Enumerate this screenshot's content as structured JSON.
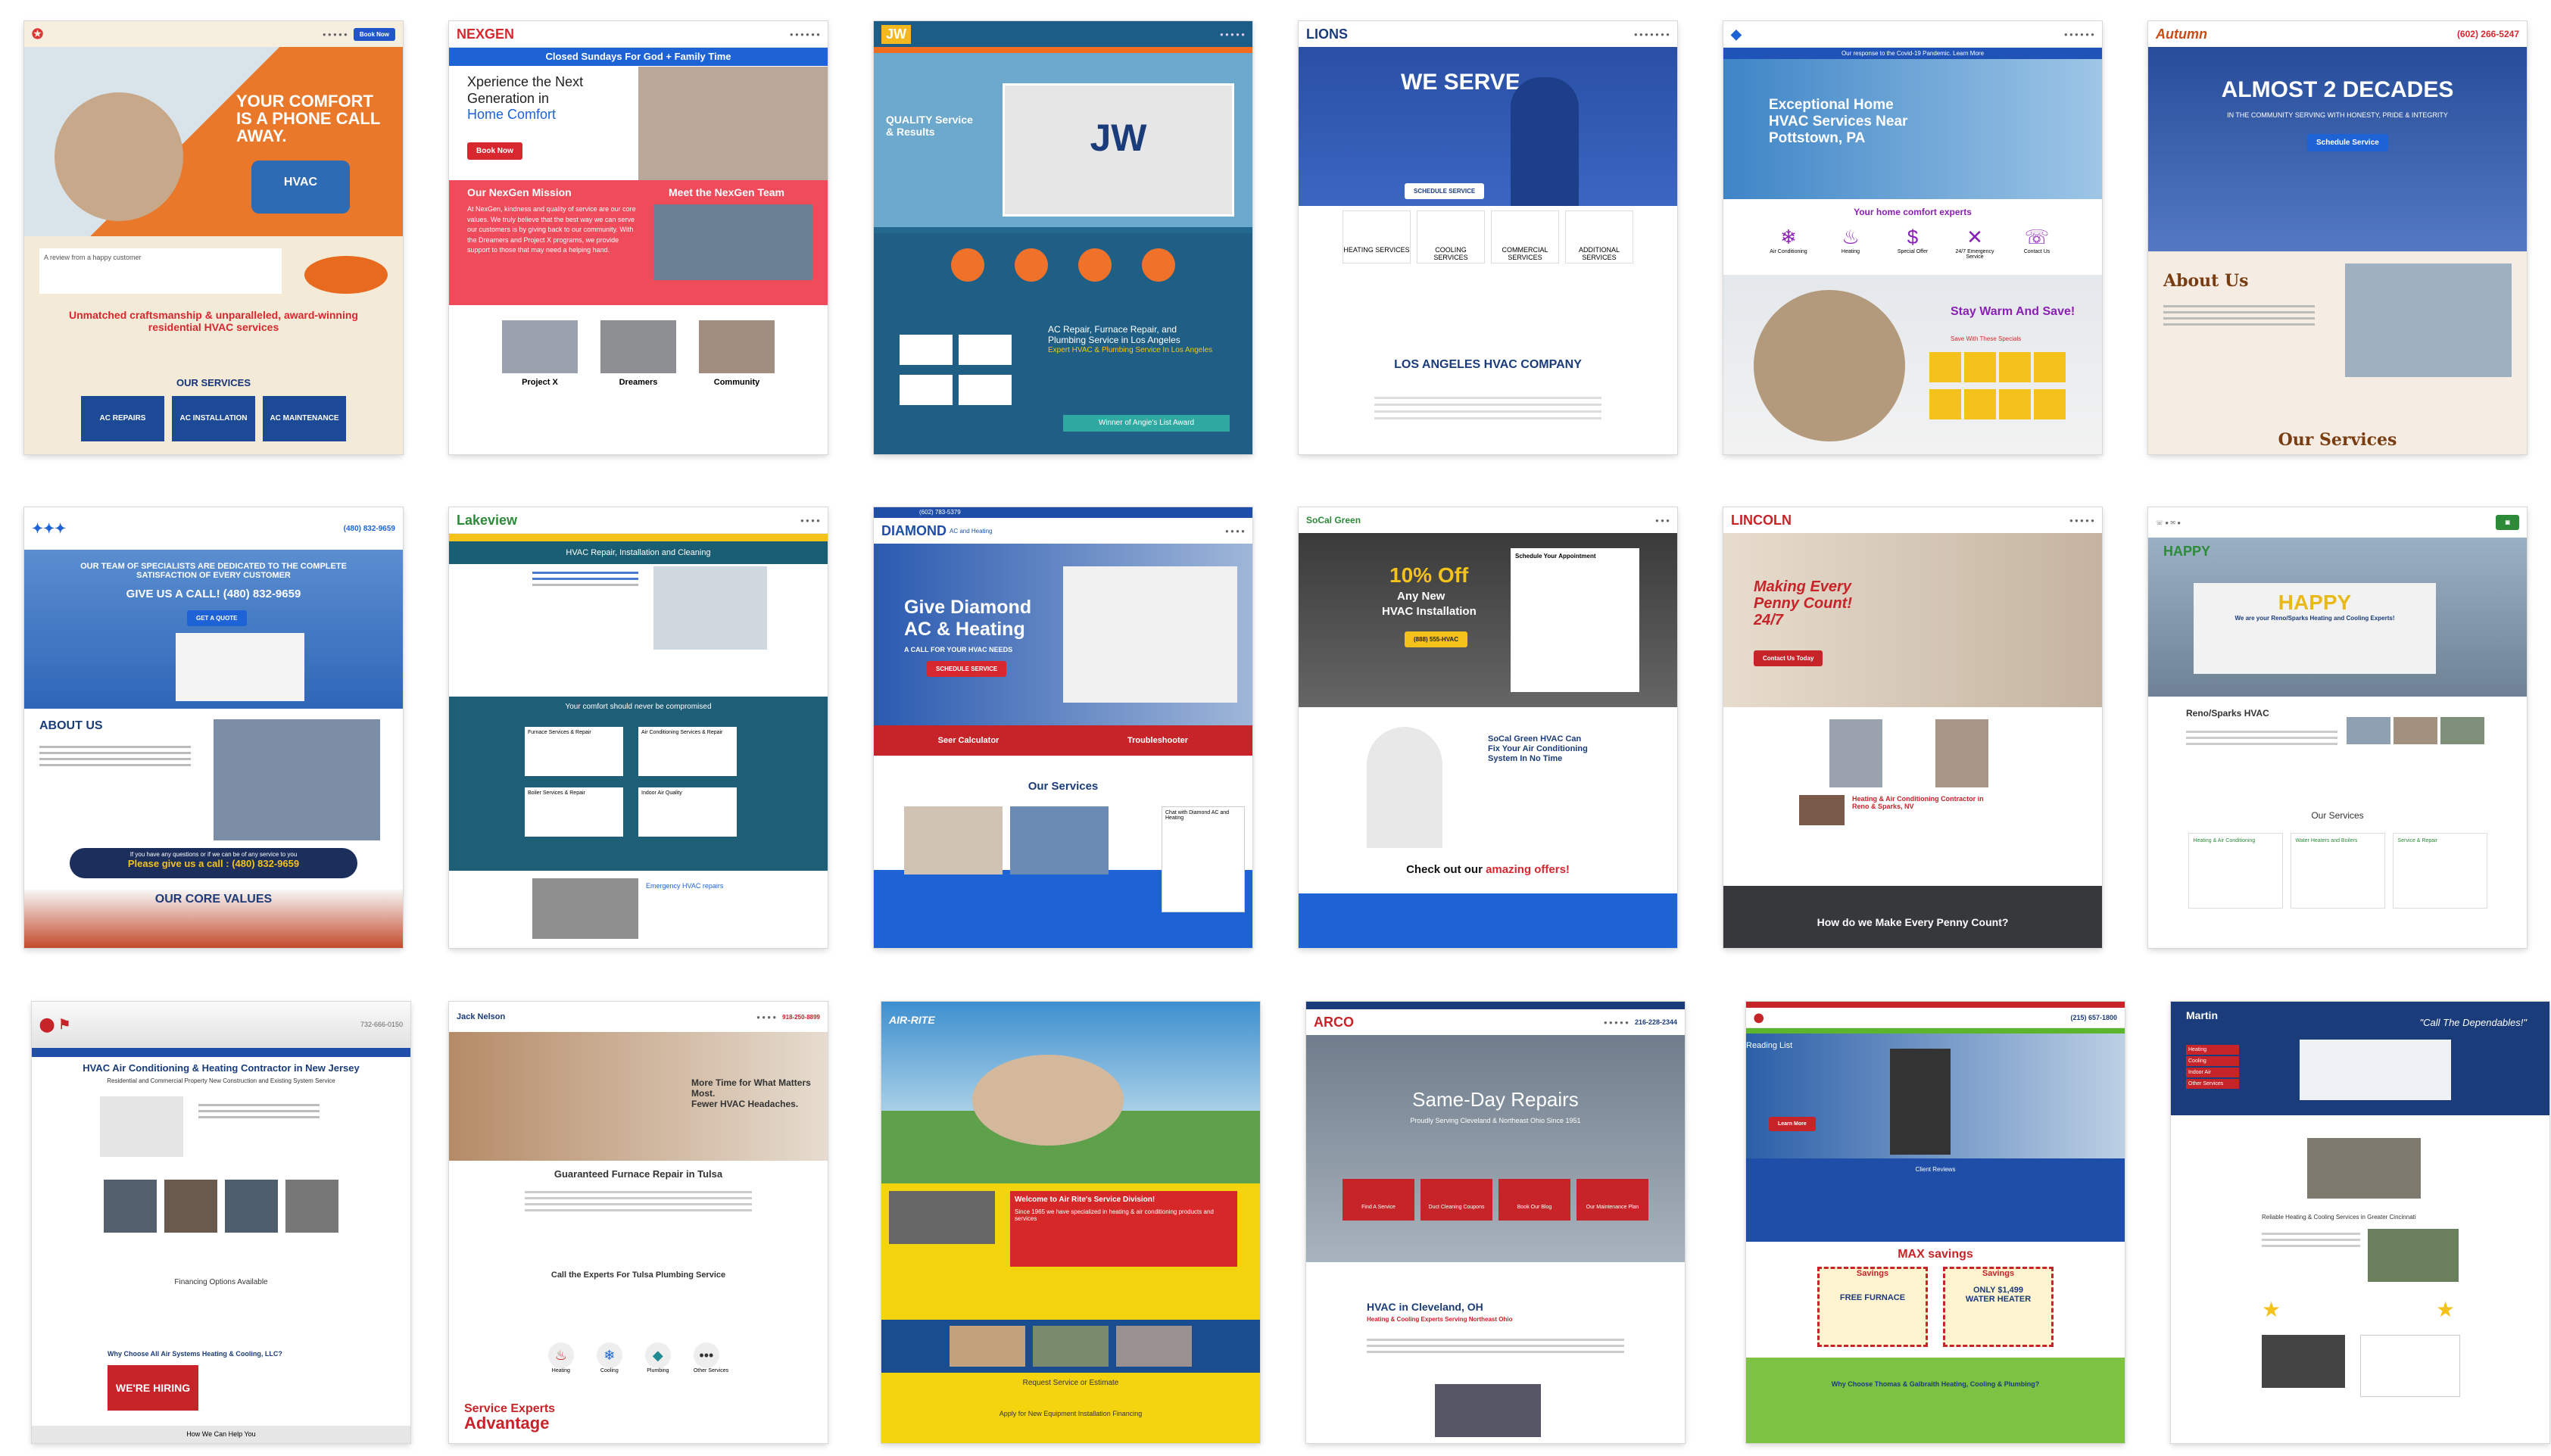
{
  "sites": [
    {
      "id": "s1",
      "logo": "✪",
      "hero": "YOUR COMFORT IS A PHONE CALL AWAY.",
      "tagline": "Unmatched craftsmanship & unparalleled, award-winning residential HVAC services",
      "section": "OUR SERVICES",
      "services": [
        "AC REPAIRS",
        "AC INSTALLATION",
        "AC MAINTENANCE"
      ],
      "van": "HVAC",
      "btn": "Book Now"
    },
    {
      "id": "s2",
      "logo": "NEXGEN",
      "banner": "Closed Sundays For God + Family Time",
      "hero1": "Xperience the Next Generation in",
      "hero2": "Home Comfort",
      "mission": "Our NexGen Mission",
      "team": "Meet the NexGen Team",
      "mission_text": "At NexGen, kindness and quality of service are our core values. We truly believe that the best way we can serve our customers is by giving back to our community. With the Dreamers and Project X programs, we provide support to those that may need a helping hand.",
      "cards": [
        "Project X",
        "Dreamers",
        "Community"
      ],
      "btn": "Book Now"
    },
    {
      "id": "s3",
      "logo": "JW",
      "quality": "QUALITY Service & Results",
      "headline1": "AC Repair, Furnace Repair, and",
      "headline2": "Plumbing Service in Los Angeles",
      "headline3": "Expert HVAC & Plumbing Service In Los Angeles",
      "award": "Winner of Angie's List Award"
    },
    {
      "id": "s4",
      "logo": "LIONS",
      "hero": "WE SERVE",
      "cta": "SCHEDULE SERVICE",
      "services": [
        "HEATING SERVICES",
        "COOLING SERVICES",
        "COMMERCIAL SERVICES",
        "ADDITIONAL SERVICES"
      ],
      "company": "LOS ANGELES HVAC COMPANY"
    },
    {
      "id": "s5",
      "topbar": "Our response to the Covid-19 Pandemic. Learn More",
      "hero": "Exceptional Home HVAC Services Near Pottstown, PA",
      "experts": "Your home comfort experts",
      "icons": [
        "Air Conditioning",
        "Heating",
        "Special Offer",
        "24/7 Emergency Service",
        "Contact Us"
      ],
      "promo": "Stay Warm And Save!",
      "promo_sub": "Save With These Specials"
    },
    {
      "id": "s6",
      "phone": "(602) 266-5247",
      "logo": "Autumn",
      "hero": "ALMOST 2 DECADES",
      "hero_sub": "IN THE COMMUNITY SERVING WITH HONESTY, PRIDE & INTEGRITY",
      "btn": "Schedule Service",
      "about": "About Us",
      "services": "Our Services"
    },
    {
      "id": "s7",
      "phone": "(480) 832-9659",
      "hero": "OUR TEAM OF SPECIALISTS ARE DEDICATED TO THE COMPLETE SATISFACTION OF EVERY CUSTOMER",
      "call": "GIVE US A CALL! (480) 832-9659",
      "btn": "GET A QUOTE",
      "about": "ABOUT US",
      "question": "If you have any questions or if we can be of any service to you",
      "please": "Please give us a call : (480) 832-9659",
      "values": "OUR CORE VALUES"
    },
    {
      "id": "s8",
      "logo": "Lakeview",
      "hero": "HVAC Repair, Installation and Cleaning",
      "comfort": "Your comfort should never be compromised",
      "emergency": "Emergency HVAC repairs",
      "boxes": [
        "Furnace Services & Repair",
        "Air Conditioning Services & Repair",
        "Boiler Services & Repair",
        "Indoor Air Quality"
      ]
    },
    {
      "id": "s9",
      "phone": "(602) 783-5379",
      "logo": "DIAMOND",
      "logo_sub": "AC and Heating",
      "hero1": "Give Diamond",
      "hero2": "AC & Heating",
      "hero3": "A CALL FOR YOUR HVAC NEEDS",
      "btn": "SCHEDULE SERVICE",
      "calc": "Seer Calculator",
      "trouble": "Troubleshooter",
      "services": "Our Services",
      "chat": "Chat with Diamond AC and Heating"
    },
    {
      "id": "s10",
      "logo": "SoCal Green",
      "offer1": "10% Off",
      "offer2": "Any New",
      "offer3": "HVAC Installation",
      "appt": "Schedule Your Appointment",
      "fix1": "SoCal Green HVAC Can",
      "fix2": "Fix Your Air Conditioning",
      "fix3": "System In No Time",
      "check1": "Check out our",
      "check2": "amazing offers!",
      "btn": "(888) 555-HVAC"
    },
    {
      "id": "s11",
      "logo": "LINCOLN",
      "hero1": "Making Every",
      "hero2": "Penny Count!",
      "hero3": "24/7",
      "btn": "Contact Us Today",
      "contractor": "Heating & Air Conditioning Contractor in Reno & Sparks, NV",
      "bottom": "How do we Make Every Penny Count?"
    },
    {
      "id": "s12",
      "logo": "HAPPY",
      "van": "HAPPY",
      "van2": "We are your Reno/Sparks Heating and Cooling Experts!",
      "title": "Reno/Sparks HVAC",
      "services": "Our Services",
      "boxes": [
        "Heating & Air Conditioning",
        "Water Heaters and Boilers",
        "Service & Repair"
      ]
    },
    {
      "id": "s13",
      "phone": "732-666-0150",
      "hero": "HVAC Air Conditioning & Heating Contractor in New Jersey",
      "hero_sub": "Residential and Commercial Property New Construction and Existing System Service",
      "financing": "Financing Options Available",
      "why": "Why Choose All Air Systems Heating & Cooling, LLC?",
      "hiring": "WE'RE HIRING",
      "help": "How We Can Help You"
    },
    {
      "id": "s14",
      "logo": "Jack Nelson",
      "phone": "918-250-8899",
      "hero1": "More Time for What Matters Most.",
      "hero2": "Fewer HVAC Headaches.",
      "headline": "Guaranteed Furnace Repair in Tulsa",
      "experts": "Call the Experts For Tulsa Plumbing Service",
      "icons": [
        "Heating",
        "Cooling",
        "Plumbing",
        "Other Services"
      ],
      "bottom1": "Service Experts",
      "bottom2": "Advantage"
    },
    {
      "id": "s15",
      "logo": "AIR-RITE",
      "welcome": "Welcome to Air Rite's Service Division!",
      "since": "Since 1965 we have specialized in heating & air conditioning products and services",
      "request": "Request Service or Estimate",
      "apply": "Apply for New Equipment Installation Financing"
    },
    {
      "id": "s16",
      "phone": "216-228-2344",
      "logo": "ARCO",
      "hero": "Same-Day Repairs",
      "hero_sub": "Proudly Serving Cleveland & Northeast Ohio Since 1951",
      "icons": [
        "Find A Service",
        "Duct Cleaning Coupons",
        "Book Our Blog",
        "Our Maintenance Plan"
      ],
      "title": "HVAC in Cleveland, OH",
      "title_sub": "Heating & Cooling Experts Serving Northeast Ohio"
    },
    {
      "id": "s17",
      "phone": "(215) 657-1800",
      "reading": "Reading List",
      "learn": "Learn More",
      "client": "Client Reviews",
      "max": "MAX savings",
      "coupon1": "Savings",
      "coupon2": "FREE FURNACE",
      "coupon3": "ONLY $1,499",
      "coupon4": "WATER HEATER",
      "why": "Why Choose Thomas & Galbraith Heating, Cooling & Plumbing?"
    },
    {
      "id": "s18",
      "logo": "Martin",
      "motto": "\"Call The Dependables!\"",
      "services": "Reliable Heating & Cooling Services in Greater Cincinnati",
      "menu": [
        "Heating",
        "Cooling",
        "Indoor Air",
        "Other Services"
      ]
    }
  ],
  "colors": {
    "navy": "#16337a",
    "red": "#d7282f",
    "orange": "#e86a1f",
    "yellow": "#f4c21a",
    "teal": "#1f8a91",
    "green": "#4aa837"
  }
}
